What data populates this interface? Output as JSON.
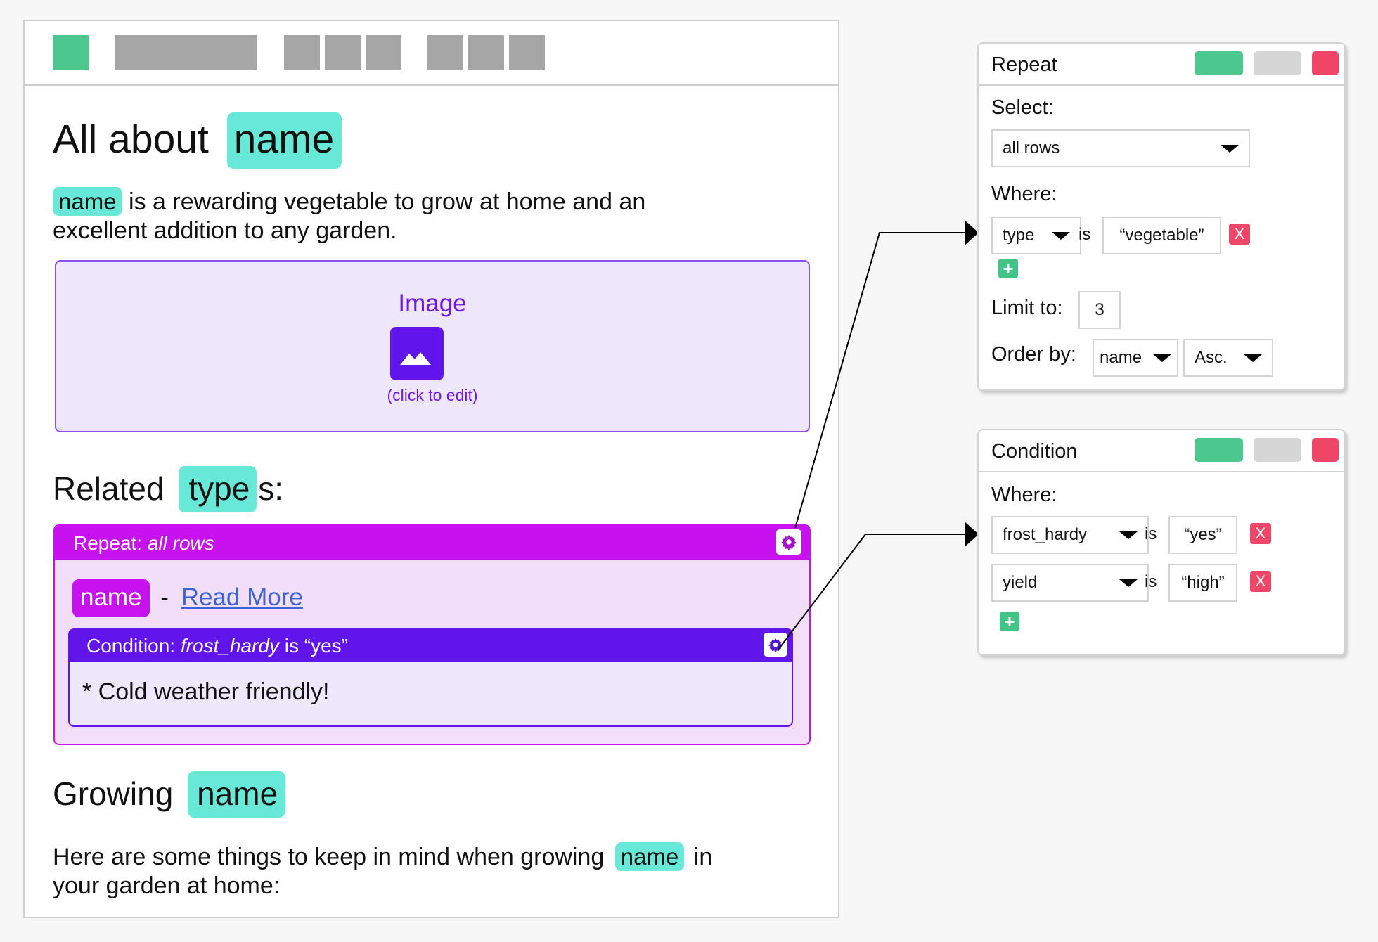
{
  "title": {
    "prefix": "All about",
    "token": "name"
  },
  "intro": {
    "token": "name",
    "line1": "is a rewarding vegetable to grow at home and an",
    "line2": "excellent addition to any garden."
  },
  "image_block": {
    "label": "Image",
    "hint": "(click to edit)"
  },
  "related": {
    "prefix": "Related",
    "token": "type",
    "suffix": "s:"
  },
  "repeat_block": {
    "header_prefix": "Repeat:",
    "header_value": "all rows",
    "row": {
      "token": "name",
      "separator": "-",
      "link": "Read More"
    },
    "condition": {
      "header_prefix": "Condition:",
      "field": "frost_hardy",
      "op": "is",
      "value": "“yes”",
      "body": "* Cold weather friendly!"
    }
  },
  "growing": {
    "prefix": "Growing",
    "token": "name",
    "line1_pre": "Here are some things to keep in mind when growing",
    "token2": "name",
    "line1_post": "in",
    "line2": "your garden at home:"
  },
  "repeat_panel": {
    "title": "Repeat",
    "select_label": "Select:",
    "select_value": "all rows",
    "where_label": "Where:",
    "where": [
      {
        "field": "type",
        "op": "is",
        "value": "“vegetable”",
        "remove": "X"
      }
    ],
    "add": "+",
    "limit_label": "Limit to:",
    "limit_value": "3",
    "order_label": "Order by:",
    "order_field": "name",
    "order_dir": "Asc."
  },
  "condition_panel": {
    "title": "Condition",
    "where_label": "Where:",
    "where": [
      {
        "field": "frost_hardy",
        "op": "is",
        "value": "“yes”",
        "remove": "X"
      },
      {
        "field": "yield",
        "op": "is",
        "value": "“high”",
        "remove": "X"
      }
    ],
    "add": "+"
  },
  "colors": {
    "token": "#68e8d7",
    "repeat": "#c711ef",
    "condition": "#6215ea",
    "ok": "#4cc78e",
    "cancel": "#d6d6d6",
    "close": "#ef4566"
  }
}
